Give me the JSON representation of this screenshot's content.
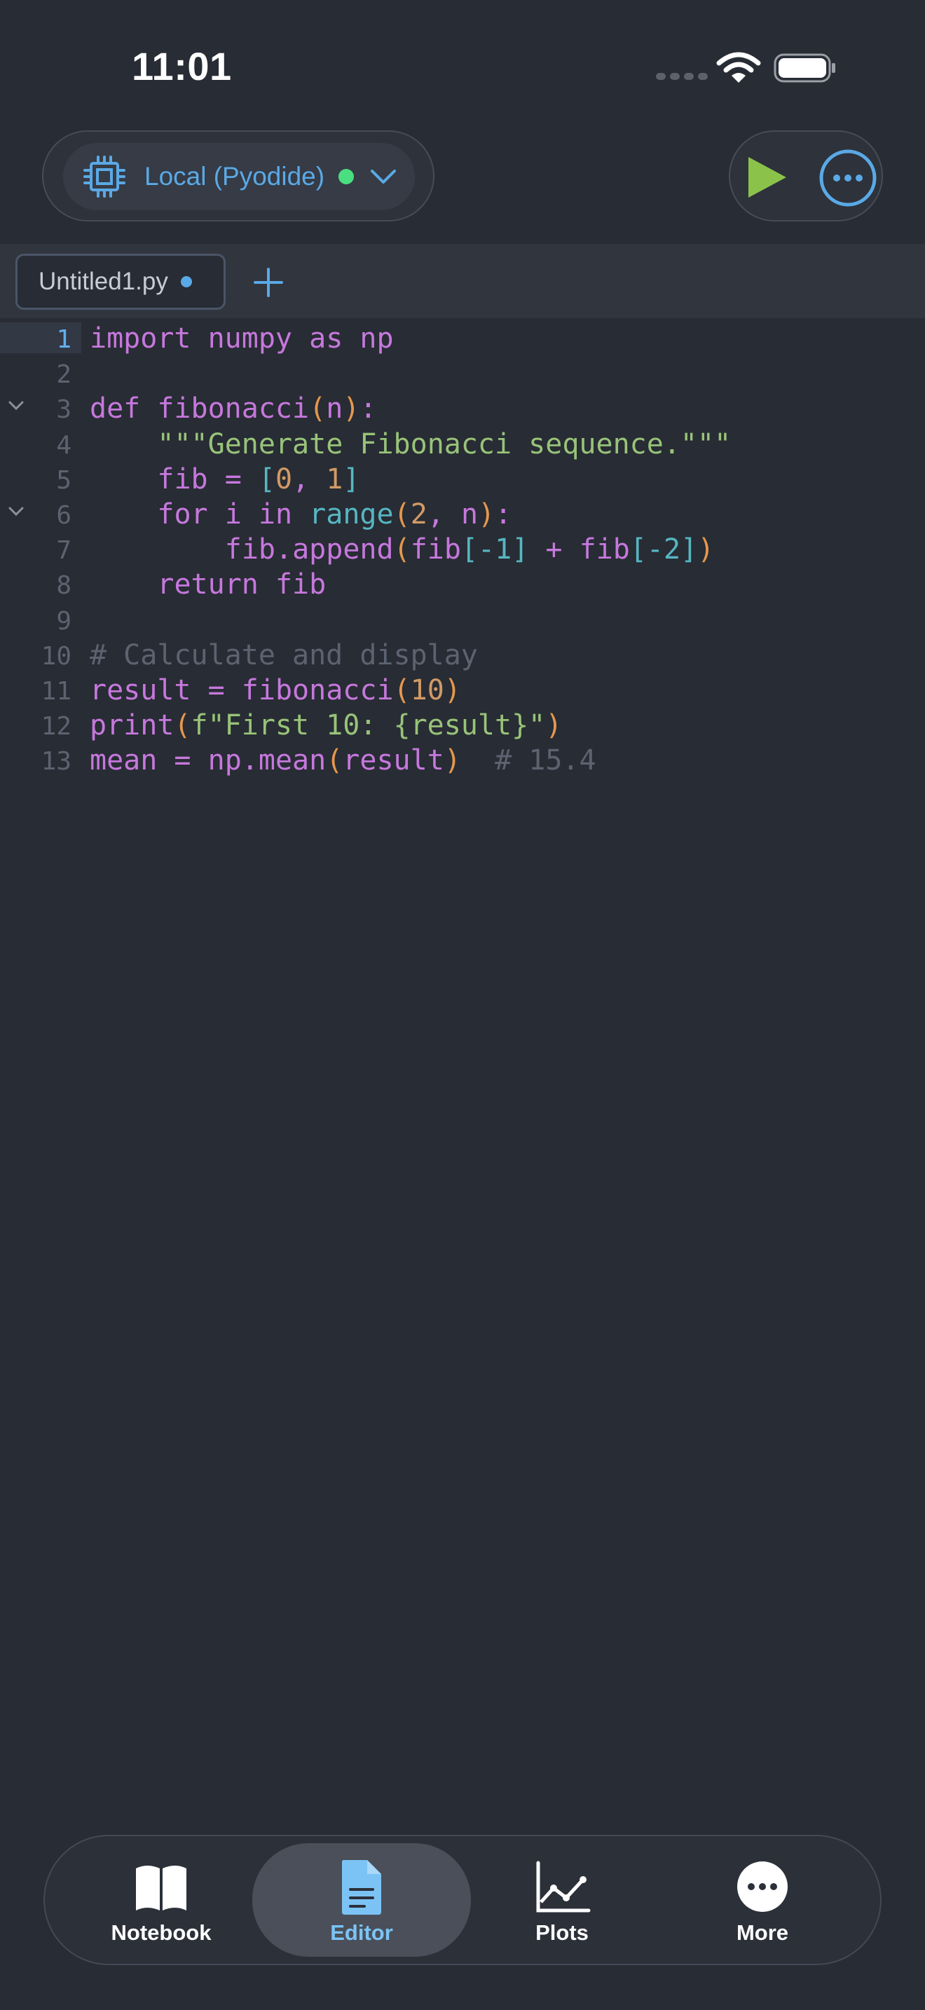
{
  "status_bar": {
    "time": "11:01"
  },
  "kernel": {
    "label": "Local (Pyodide)",
    "status_color": "#4ade80"
  },
  "tabs": [
    {
      "label": "Untitled1.py",
      "unsaved": true
    }
  ],
  "editor": {
    "active_line": 1,
    "lines": [
      {
        "n": "1",
        "text": "import numpy as np"
      },
      {
        "n": "2",
        "text": ""
      },
      {
        "n": "3",
        "text": "def fibonacci(n):",
        "fold": true
      },
      {
        "n": "4",
        "text": "    \"\"\"Generate Fibonacci sequence.\"\"\""
      },
      {
        "n": "5",
        "text": "    fib = [0, 1]"
      },
      {
        "n": "6",
        "text": "    for i in range(2, n):",
        "fold": true
      },
      {
        "n": "7",
        "text": "        fib.append(fib[-1] + fib[-2])"
      },
      {
        "n": "8",
        "text": "    return fib"
      },
      {
        "n": "9",
        "text": ""
      },
      {
        "n": "10",
        "text": "# Calculate and display"
      },
      {
        "n": "11",
        "text": "result = fibonacci(10)"
      },
      {
        "n": "12",
        "text": "print(f\"First 10: {result}\")"
      },
      {
        "n": "13",
        "text": "mean = np.mean(result)  # 15.4"
      }
    ]
  },
  "nav": {
    "items": [
      {
        "label": "Notebook",
        "icon": "book-icon"
      },
      {
        "label": "Editor",
        "icon": "document-icon",
        "active": true
      },
      {
        "label": "Plots",
        "icon": "chart-icon"
      },
      {
        "label": "More",
        "icon": "more-icon"
      }
    ]
  },
  "colors": {
    "accent": "#5aa9e6",
    "background": "#282c34",
    "run": "#8bc34a"
  }
}
